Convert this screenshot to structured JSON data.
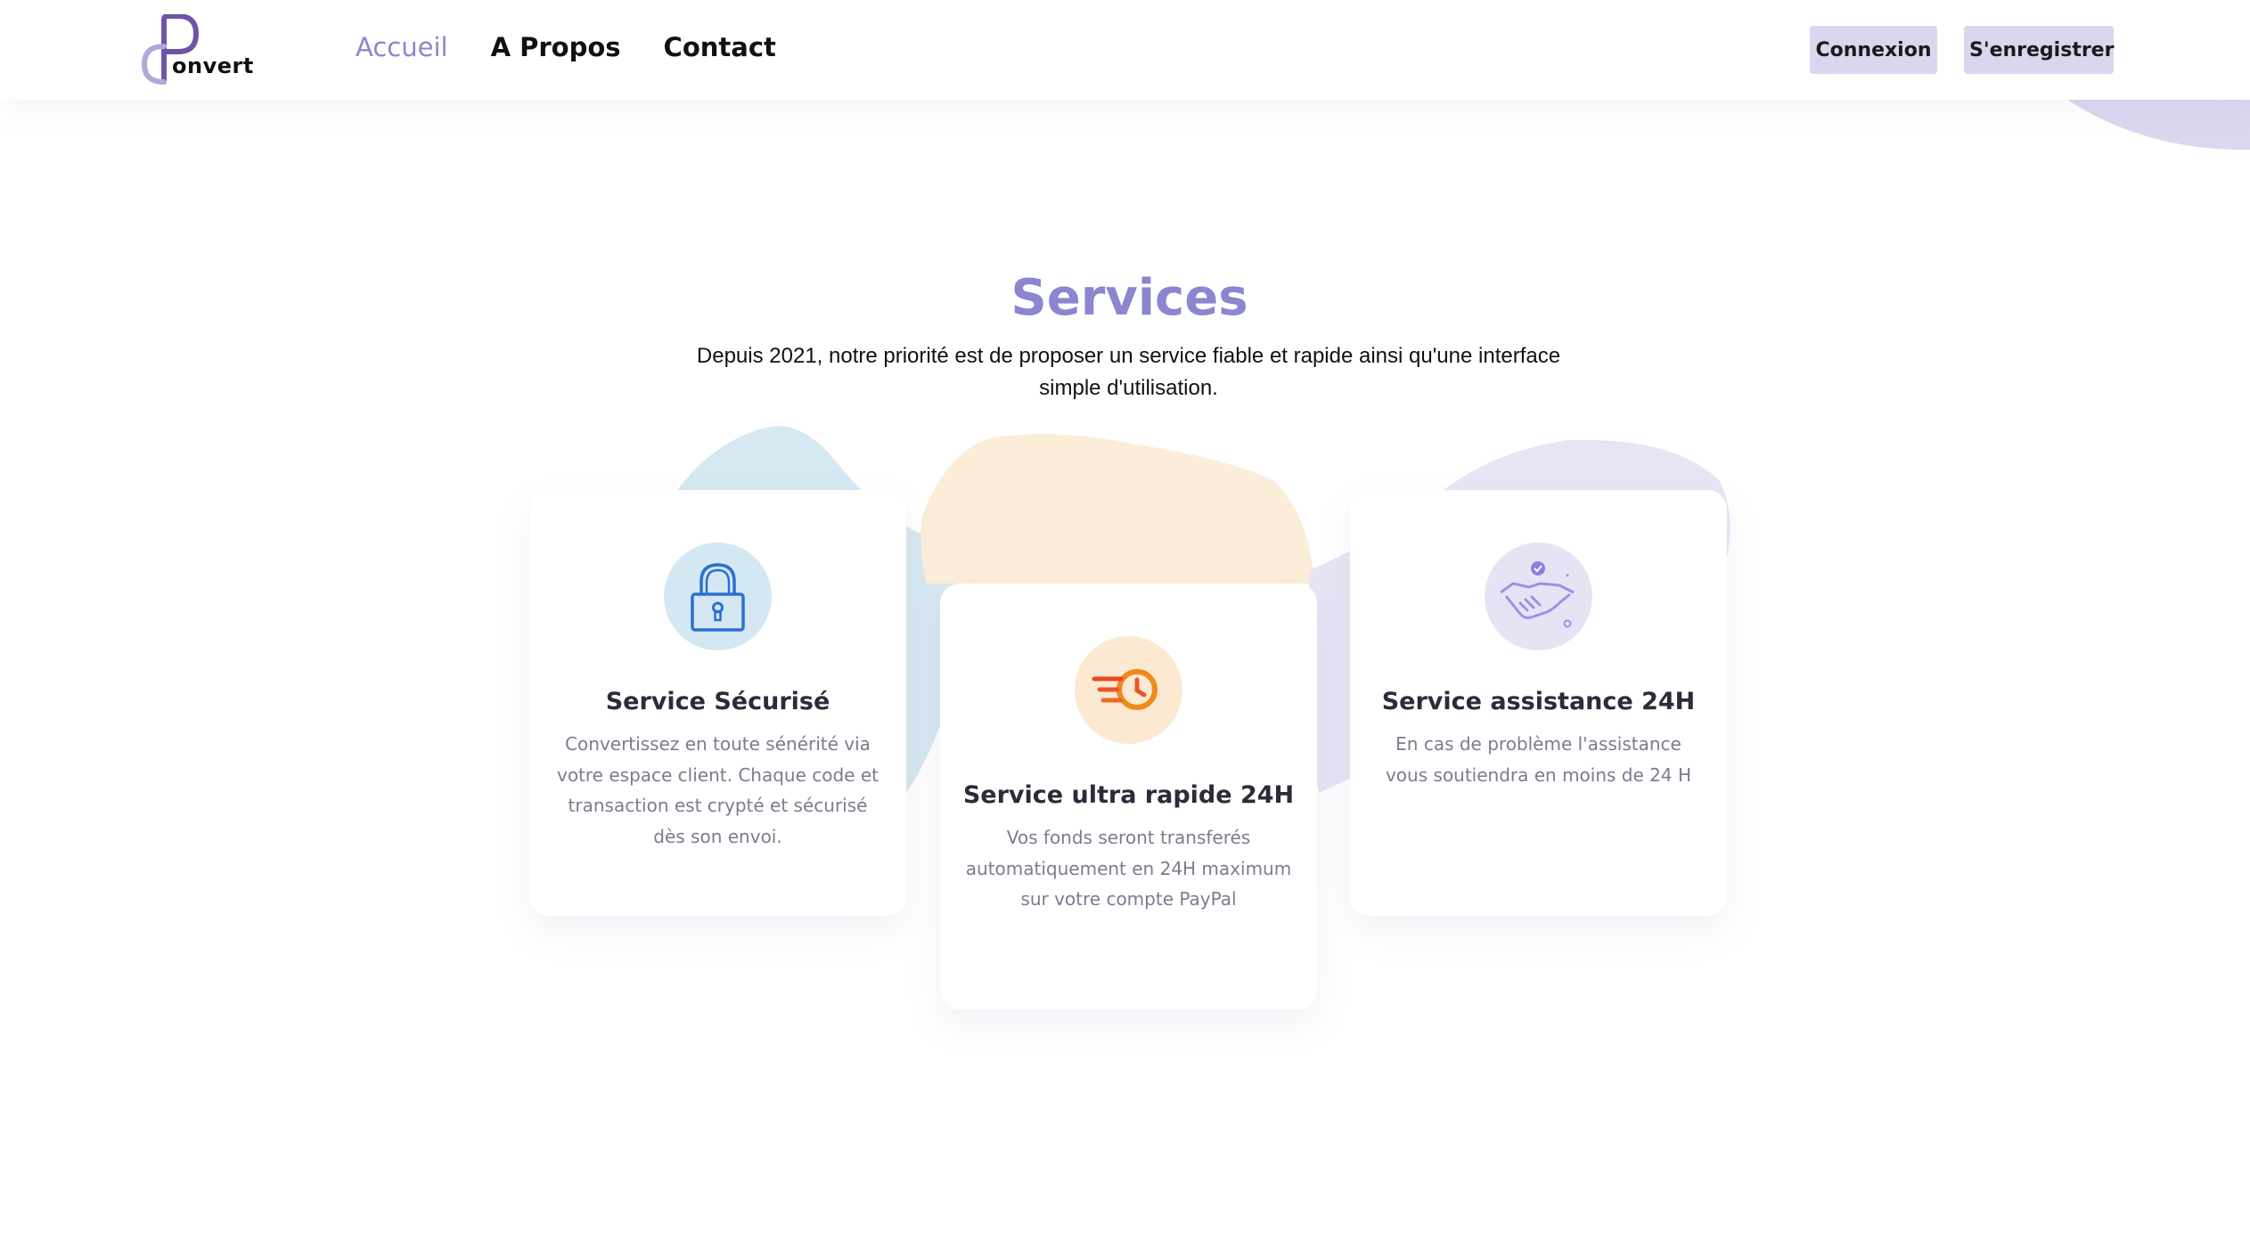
{
  "header": {
    "logo": {
      "mark": "C",
      "text": "onvert"
    },
    "nav": [
      {
        "label": "Accueil",
        "active": true
      },
      {
        "label": "A Propos",
        "active": false
      },
      {
        "label": "Contact",
        "active": false
      }
    ],
    "login_label": "Connexion",
    "register_label": "S'enregistrer"
  },
  "services": {
    "title": "Services",
    "subtitle": "Depuis 2021, notre priorité est de proposer un service fiable et rapide ainsi qu'une interface simple d'utilisation.",
    "cards": [
      {
        "icon": "lock-icon",
        "title": "Service Sécurisé",
        "text": "Convertissez en toute sénérité via votre espace client. Chaque code et transaction est crypté et sécurisé dès son envoi."
      },
      {
        "icon": "fast-clock-icon",
        "title": "Service ultra rapide 24H",
        "text": "Vos fonds seront transferés automatiquement en 24H maximum sur votre compte PayPal"
      },
      {
        "icon": "handshake-icon",
        "title": "Service assistance 24H",
        "text": "En cas de problème l'assistance vous soutiendra en moins de 24 H"
      }
    ]
  },
  "colors": {
    "accent": "#8b86cf",
    "button_bg": "#d9d6ee",
    "blue_circle": "#d4e8f3",
    "orange_circle": "#fbe9d1",
    "purple_circle": "#e6e4f4",
    "blob_blue": "#d6e8f2",
    "blob_orange": "#fbedd8",
    "blob_purple": "#e6e5f5"
  }
}
